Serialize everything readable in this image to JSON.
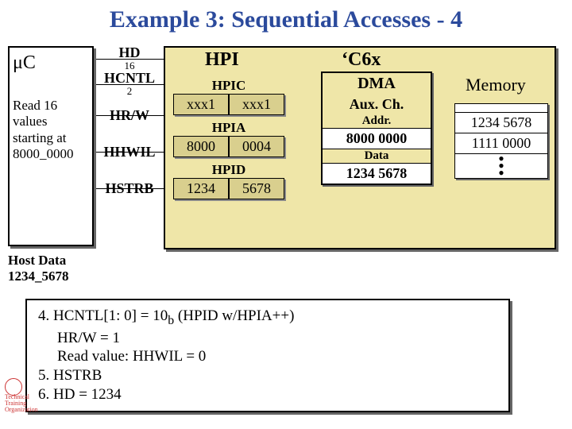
{
  "title": "Example 3: Sequential Accesses - 4",
  "uc": {
    "label": "μC",
    "text_l1": "Read 16",
    "text_l2": "values",
    "text_l3": "starting at",
    "text_l4": "8000_0000"
  },
  "signals": {
    "hd": {
      "name": "HD",
      "width": "16"
    },
    "hcntl": {
      "name": "HCNTL",
      "width": "2"
    },
    "hrw": {
      "name": "HR/W"
    },
    "hhwil": {
      "name": "HHWIL"
    },
    "hstrb": {
      "name": "HSTRB"
    }
  },
  "hpi": {
    "label": "HPI",
    "c6x": "‘C6x",
    "hpic": {
      "title": "HPIC",
      "hi": "xxx1",
      "lo": "xxx1"
    },
    "hpia": {
      "title": "HPIA",
      "hi": "8000",
      "lo": "0004"
    },
    "hpid": {
      "title": "HPID",
      "hi": "1234",
      "lo": "5678"
    }
  },
  "dma": {
    "head_l1": "DMA",
    "head_l2": "Aux. Ch.",
    "addr_lbl": "Addr.",
    "addr": "8000 0000",
    "data_lbl": "Data",
    "data": "1234 5678"
  },
  "memory": {
    "label": "Memory",
    "rows": [
      "1234 5678",
      "1111 0000"
    ]
  },
  "hostdata": {
    "l1": "Host Data",
    "l2": "1234_5678"
  },
  "steps": {
    "s4a": "4. HCNTL[1: 0] = 10",
    "s4a_sub": "b",
    "s4a_tail": " (HPID w/HPIA++)",
    "s4b": "HR/W = 1",
    "s4c": "Read value: HHWIL = 0",
    "s5": "5. HSTRB",
    "s6": "6. HD = 1234"
  },
  "logo": {
    "l1": "Technical",
    "l2": "Training",
    "l3": "Organization"
  }
}
